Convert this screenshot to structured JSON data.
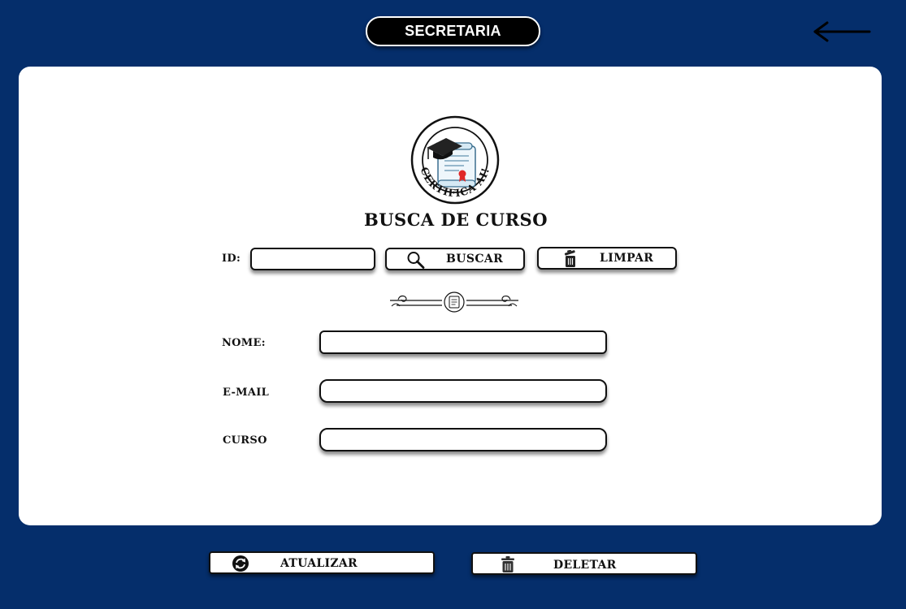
{
  "header": {
    "title": "SECRETARIA",
    "back_icon": "arrow-left-icon"
  },
  "logo": {
    "text": "CERTIFICA AI!",
    "icon": "graduation-certificate-logo"
  },
  "page_title": "BUSCA DE CURSO",
  "search": {
    "id_label": "ID:",
    "id_value": "",
    "search_button": "BUSCAR",
    "search_icon": "magnifier-icon",
    "clear_button": "LIMPAR",
    "clear_icon": "trash-icon"
  },
  "divider_icon": "ornamental-scroll-divider",
  "form": {
    "name_label": "NOME:",
    "name_value": "",
    "email_label": "E-MAIL",
    "email_value": "",
    "course_label": "CURSO",
    "course_value": ""
  },
  "actions": {
    "update_button": "ATUALIZAR",
    "update_icon": "refresh-icon",
    "delete_button": "DELETAR",
    "delete_icon": "trash-icon"
  },
  "colors": {
    "background": "#052e6b",
    "card": "#ffffff",
    "pill": "#000000",
    "text": "#111111"
  }
}
